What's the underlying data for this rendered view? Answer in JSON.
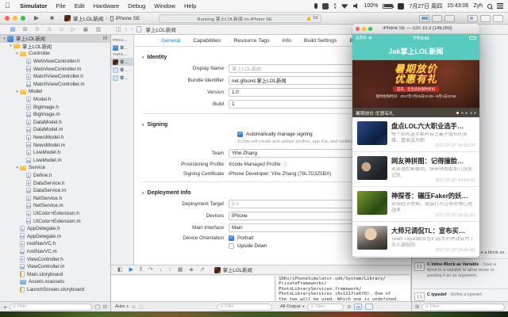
{
  "menu_bar": {
    "menus": [
      "Simulator",
      "File",
      "Edit",
      "Hardware",
      "Debug",
      "Window",
      "Help"
    ],
    "battery": "100%",
    "date": "7月27日 周四",
    "time": "15:43:06",
    "user": "Zyh"
  },
  "xcode": {
    "toolbar": {
      "scheme": "掌上LOL新闻",
      "run_destination": "iPhone SE",
      "status": "Running 掌上LOL新闻 on iPhone SE",
      "warning_count": "19"
    },
    "navigator_icons": [
      "project-navigator",
      "symbol-navigator",
      "find-navigator",
      "issue-navigator",
      "test-navigator",
      "debug-navigator",
      "breakpoint-navigator",
      "report-navigator"
    ],
    "jump_bar": {
      "file": "掌上LOL新闻"
    },
    "navigator": {
      "filter_placeholder": "Filter",
      "tree": [
        {
          "label": "掌上LOL新闻",
          "type": "project",
          "indent": 0,
          "badge": "M",
          "selected": true,
          "disclosure": true
        },
        {
          "label": "掌上LOL新闻",
          "type": "folder",
          "indent": 1,
          "disclosure": true
        },
        {
          "label": "Controller",
          "type": "folder",
          "indent": 2,
          "disclosure": true
        },
        {
          "label": "WebViewController.h",
          "type": "h",
          "indent": 3
        },
        {
          "label": "WebViewController.m",
          "type": "m",
          "indent": 3
        },
        {
          "label": "MatchViewController.h",
          "type": "h",
          "indent": 3
        },
        {
          "label": "MatchViewController.m",
          "type": "m",
          "indent": 3
        },
        {
          "label": "Model",
          "type": "folder",
          "indent": 2,
          "disclosure": true
        },
        {
          "label": "Model.h",
          "type": "h",
          "indent": 3
        },
        {
          "label": "BigImage.h",
          "type": "h",
          "indent": 3
        },
        {
          "label": "BigImage.m",
          "type": "m",
          "indent": 3
        },
        {
          "label": "DataModel.h",
          "type": "h",
          "indent": 3
        },
        {
          "label": "DataModel.m",
          "type": "m",
          "indent": 3
        },
        {
          "label": "NewsModel.h",
          "type": "h",
          "indent": 3
        },
        {
          "label": "NewsModel.m",
          "type": "m",
          "indent": 3
        },
        {
          "label": "LiveModel.h",
          "type": "h",
          "indent": 3
        },
        {
          "label": "LiveModel.m",
          "type": "m",
          "indent": 3
        },
        {
          "label": "Service",
          "type": "folder",
          "indent": 2,
          "disclosure": true
        },
        {
          "label": "Define.h",
          "type": "h",
          "indent": 3
        },
        {
          "label": "DataService.h",
          "type": "h",
          "indent": 3
        },
        {
          "label": "DataService.m",
          "type": "m",
          "indent": 3
        },
        {
          "label": "NetService.h",
          "type": "h",
          "indent": 3
        },
        {
          "label": "NetService.m",
          "type": "m",
          "indent": 3
        },
        {
          "label": "UIColor+Extension.h",
          "type": "h",
          "indent": 3
        },
        {
          "label": "UIColor+Extension.m",
          "type": "m",
          "indent": 3
        },
        {
          "label": "AppDelegate.h",
          "type": "h",
          "indent": 2
        },
        {
          "label": "AppDelegate.m",
          "type": "m",
          "indent": 2
        },
        {
          "label": "rootNavVC.h",
          "type": "h",
          "indent": 2
        },
        {
          "label": "rootNavVC.m",
          "type": "m",
          "indent": 2
        },
        {
          "label": "ViewController.h",
          "type": "h",
          "indent": 2
        },
        {
          "label": "ViewController.m",
          "type": "m",
          "indent": 2
        },
        {
          "label": "Main.storyboard",
          "type": "storyboard",
          "indent": 2
        },
        {
          "label": "Assets.xcassets",
          "type": "assets",
          "indent": 2
        },
        {
          "label": "LaunchScreen.storyboard",
          "type": "storyboard",
          "indent": 2
        }
      ]
    },
    "editor": {
      "tabs": [
        "General",
        "Capabilities",
        "Resource Tags",
        "Info",
        "Build Settings",
        "Build Phases"
      ],
      "selected_tab": "General",
      "sidebar": {
        "projects_header": "PROJ…",
        "project_item": "掌…",
        "targets_header": "TARG…",
        "target_item": "掌…",
        "test_item_1": "掌…",
        "test_item_2": "掌…"
      },
      "identity": {
        "section": "Identity",
        "display_name_label": "Display Name",
        "display_name_value": "掌上LOL新闻",
        "bundle_label": "Bundle Identifier",
        "bundle_value": "net.gfound.掌上LOL新闻",
        "version_label": "Version",
        "version_value": "1.0",
        "build_label": "Build",
        "build_value": "1"
      },
      "signing": {
        "section": "Signing",
        "auto_label": "Automatically manage signing",
        "auto_desc": "Xcode will create and update profiles, app IDs, and certificates.",
        "team_label": "Team",
        "team_value": "Yihe Zhang",
        "profile_label": "Provisioning Profile",
        "profile_value": "Xcode Managed Profile",
        "cert_label": "Signing Certificate",
        "cert_value": "iPhone Developer: Yihe Zhang (78L7D3Z5BX)"
      },
      "deployment": {
        "section": "Deployment Info",
        "target_label": "Deployment Target",
        "target_value": "8.3",
        "devices_label": "Devices",
        "devices_value": "iPhone",
        "interface_label": "Main Interface",
        "interface_value": "Main",
        "orientation_label": "Device Orientation",
        "portrait_label": "Portrait",
        "upside_down_label": "Upside Down"
      }
    },
    "debug": {
      "icons": [
        "hide-debug-area",
        "breakpoints",
        "pause",
        "step-over",
        "step-into",
        "step-out",
        "view-hierarchy",
        "memory-graph",
        "simulate-location"
      ],
      "process": "掌上LOL新闻",
      "variables_scope": "Auto",
      "console_scope": "All Output",
      "filter_placeholder": "Filter",
      "console_lines": [
        "SDKs/iPhoneSimulator.sdk/System/Library/",
        "PrivateFrameworks/",
        "PhotoLibraryServices.framework/",
        "PhotoLibraryServices (0x1217ce6f0). One of",
        "the two will be used. Which one is undefined."
      ]
    },
    "library": {
      "fragment": "e a block as.",
      "snippets": [
        {
          "title": "C Inline Block as Variable",
          "desc": " - Save a block to a variable to allow reuse or passing it as an argument."
        },
        {
          "title": "C typedef",
          "desc": " - Define a typedef."
        }
      ],
      "filter_placeholder": "Filter"
    }
  },
  "simulator": {
    "window_title": "iPhone SE — iOS 10.3 (14E269)",
    "status_bar": {
      "carrier": "运营商",
      "time": "下午3:43"
    },
    "nav_title": "Jak掌上LOL新闻",
    "banner": {
      "headline_1": "暑期放价",
      "headline_2": "优惠有礼",
      "strip": "首充、宝宝皮肤限时折扣",
      "time_text": "限时抢购时间：2017年7月26日10:00—8月1日23:59",
      "caption": "暑期放价 优惠有礼",
      "dot_count": 5,
      "active_dot": 0
    },
    "news": [
      {
        "title": "盘点LOL六大职业选手…",
        "subtitle": "每个知名选手都有自己最不擅长的英雄，基本成为职",
        "time": "2017-07-27 15:25:26",
        "thumb": "blue"
      },
      {
        "title": "网友神拼图：记得撞脸…",
        "subtitle": "笑笑撞脸郭敬明，快来拼图看那几张是记仇",
        "time": "2017-07-27 14:54:23",
        "thumb": "dark"
      },
      {
        "title": "神探苍：碾压Faker的妖…",
        "subtitle": "双倍经济地推，假装打不过等等博心理战术",
        "time": "2017-07-27 15:01:23",
        "thumb": "green"
      },
      {
        "title": "大师兄调侃TL：宣布买…",
        "subtitle": "Team Liquid疯狂签约选手的举动成为了众人调侃的",
        "time": "2017-07-27 14:43:49",
        "thumb": "photo"
      }
    ]
  },
  "colors": {
    "teal": "#57cbbd",
    "accent_blue": "#1d7cd8",
    "folder_yellow": "#f5b73c",
    "warning_yellow": "#f7b500",
    "battery_green": "#53d769",
    "banner_gold": "#ffd94a",
    "banner_red": "#c3291f"
  }
}
